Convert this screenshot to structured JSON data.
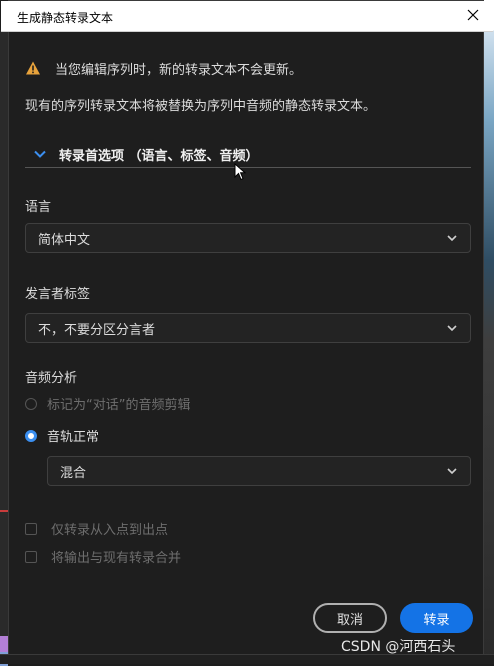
{
  "dialog": {
    "title": "生成静态转录文本",
    "warning": "当您编辑序列时，新的转录文本不会更新。",
    "info": "现有的序列转录文本将被替换为序列中音频的静态转录文本。",
    "section_label": "转录首选项 （语言、标签、音频）",
    "language": {
      "label": "语言",
      "value": "简体中文"
    },
    "speaker_labels": {
      "label": "发言者标签",
      "value": "不，不要分区分言者"
    },
    "audio_analysis": {
      "label": "音频分析",
      "options": [
        {
          "label": "标记为“对话”的音频剪辑",
          "selected": false,
          "enabled": false
        },
        {
          "label": "音轨正常",
          "selected": true,
          "enabled": true
        }
      ],
      "track_value": "混合"
    },
    "checkboxes": [
      {
        "label": "仅转录从入点到出点",
        "checked": false
      },
      {
        "label": "将输出与现有转录合并",
        "checked": false
      }
    ],
    "buttons": {
      "cancel": "取消",
      "confirm": "转录"
    }
  },
  "watermark": "CSDN @河西石头",
  "colors": {
    "accent": "#1473e6",
    "warning": "#e8a33c",
    "radio_selected": "#3b8ff0"
  },
  "icons": {
    "warning": "warning-triangle-icon",
    "close": "close-icon",
    "section_toggle": "chevron-down-icon"
  }
}
